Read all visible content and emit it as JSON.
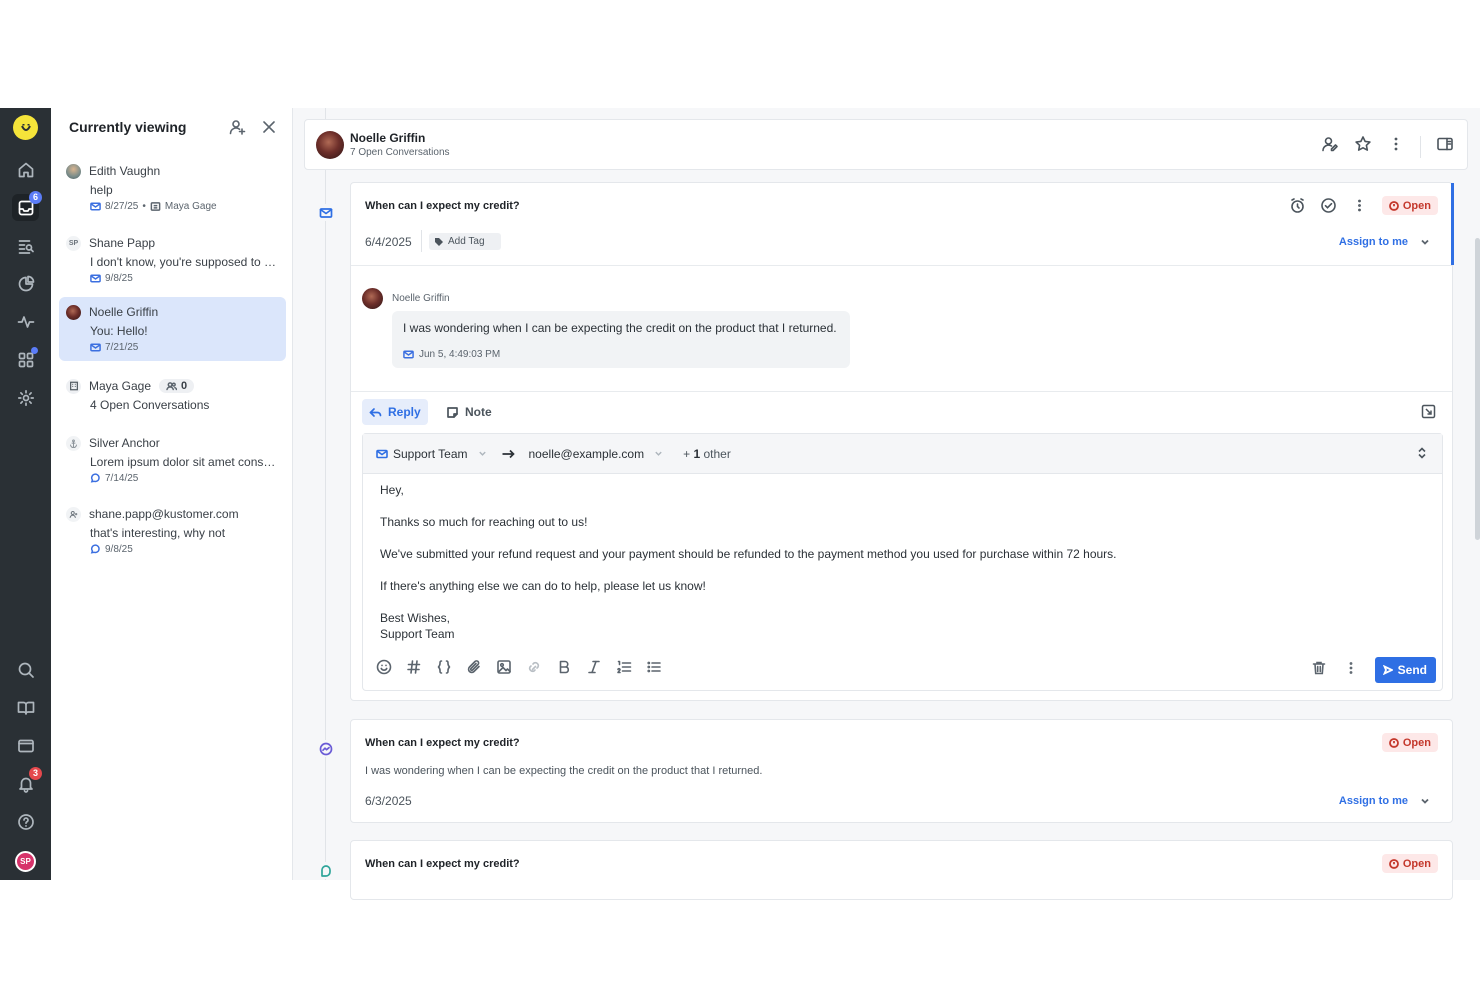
{
  "rail": {
    "inbox_badge": "6",
    "notifications_badge": "3",
    "user_initials": "SP"
  },
  "panel": {
    "title": "Currently viewing",
    "items": [
      {
        "name": "Edith Vaughn",
        "message": "help",
        "date": "8/27/25",
        "assignee": "Maya Gage"
      },
      {
        "name": "Shane Papp",
        "avatar_initials": "SP",
        "message": "I don't know, you're supposed to know",
        "date": "9/8/25"
      },
      {
        "name": "Noelle Griffin",
        "message": "You: Hello!",
        "date": "7/21/25"
      },
      {
        "name": "Maya Gage",
        "count": "0",
        "message": "4 Open Conversations"
      },
      {
        "name": "Silver Anchor",
        "message": "Lorem ipsum dolor sit amet consectetur",
        "date": "7/14/25"
      },
      {
        "name": "shane.papp@kustomer.com",
        "message": "that's interesting, why not",
        "date": "9/8/25"
      }
    ]
  },
  "header": {
    "customer_name": "Noelle Griffin",
    "subtitle": "7 Open Conversations"
  },
  "conversation1": {
    "title": "When can I expect my credit?",
    "status": "Open",
    "date": "6/4/2025",
    "add_tag": "Add Tag",
    "assign_label": "Assign to me",
    "message": {
      "author": "Noelle Griffin",
      "text": "I was wondering when I can be expecting the credit on the product that I returned.",
      "timestamp": "Jun 5, 4:49:03 PM"
    }
  },
  "composer": {
    "reply_label": "Reply",
    "note_label": "Note",
    "from": "Support Team",
    "to": "noelle@example.com",
    "other_prefix": "+",
    "other_count": "1",
    "other_suffix": "other",
    "body": {
      "greeting": "Hey,",
      "line1": "Thanks so much for reaching out to us!",
      "line2": "We've submitted your refund request and your payment should be refunded to the payment method you used for purchase within 72 hours.",
      "line3": "If there's anything else we can do to help, please let us know!",
      "signoff": "Best Wishes,",
      "signature": "Support Team"
    },
    "send_label": "Send"
  },
  "conversation2": {
    "title": "When can I expect my credit?",
    "status": "Open",
    "preview": "I was wondering when I can be expecting the credit on the product that I returned.",
    "date": "6/3/2025",
    "assign_label": "Assign to me"
  },
  "conversation3": {
    "title": "When can I expect my credit?",
    "status": "Open"
  },
  "colors": {
    "rail_bg": "#2a3035",
    "accent": "#2f6fe4",
    "open_badge_bg": "#fde8e8",
    "open_badge_text": "#c4372b",
    "selected_item": "#dbe6fb",
    "logo": "#f5e43a"
  }
}
